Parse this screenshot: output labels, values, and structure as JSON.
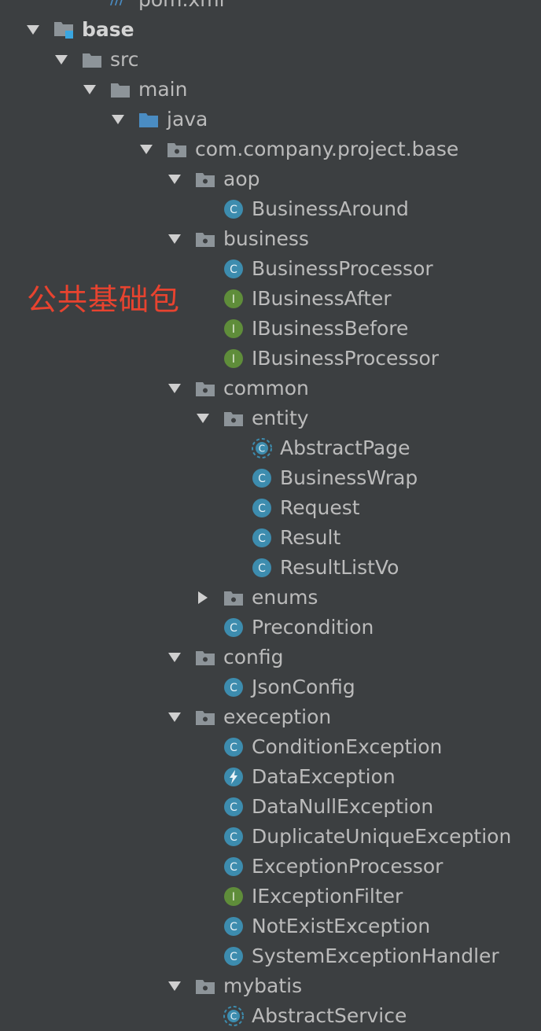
{
  "annotation": "公共基础包",
  "tree": [
    {
      "label": "pom.xml",
      "type": "pom",
      "depth": 2,
      "state": "none"
    },
    {
      "label": "base",
      "type": "module",
      "depth": 0,
      "state": "expanded",
      "bold": true
    },
    {
      "label": "src",
      "type": "folder",
      "depth": 1,
      "state": "expanded"
    },
    {
      "label": "main",
      "type": "folder",
      "depth": 2,
      "state": "expanded"
    },
    {
      "label": "java",
      "type": "source-folder",
      "depth": 3,
      "state": "expanded"
    },
    {
      "label": "com.company.project.base",
      "type": "package",
      "depth": 4,
      "state": "expanded"
    },
    {
      "label": "aop",
      "type": "package",
      "depth": 5,
      "state": "expanded"
    },
    {
      "label": "BusinessAround",
      "type": "class",
      "depth": 6,
      "state": "none"
    },
    {
      "label": "business",
      "type": "package",
      "depth": 5,
      "state": "expanded"
    },
    {
      "label": "BusinessProcessor",
      "type": "class",
      "depth": 6,
      "state": "none"
    },
    {
      "label": "IBusinessAfter",
      "type": "interface",
      "depth": 6,
      "state": "none"
    },
    {
      "label": "IBusinessBefore",
      "type": "interface",
      "depth": 6,
      "state": "none"
    },
    {
      "label": "IBusinessProcessor",
      "type": "interface",
      "depth": 6,
      "state": "none"
    },
    {
      "label": "common",
      "type": "package",
      "depth": 5,
      "state": "expanded"
    },
    {
      "label": "entity",
      "type": "package",
      "depth": 6,
      "state": "expanded"
    },
    {
      "label": "AbstractPage",
      "type": "abstract-class",
      "depth": 7,
      "state": "none"
    },
    {
      "label": "BusinessWrap",
      "type": "class",
      "depth": 7,
      "state": "none"
    },
    {
      "label": "Request",
      "type": "class",
      "depth": 7,
      "state": "none"
    },
    {
      "label": "Result",
      "type": "class",
      "depth": 7,
      "state": "none"
    },
    {
      "label": "ResultListVo",
      "type": "class",
      "depth": 7,
      "state": "none"
    },
    {
      "label": "enums",
      "type": "package",
      "depth": 6,
      "state": "collapsed"
    },
    {
      "label": "Precondition",
      "type": "class",
      "depth": 6,
      "state": "none"
    },
    {
      "label": "config",
      "type": "package",
      "depth": 5,
      "state": "expanded"
    },
    {
      "label": "JsonConfig",
      "type": "class",
      "depth": 6,
      "state": "none"
    },
    {
      "label": "exeception",
      "type": "package",
      "depth": 5,
      "state": "expanded"
    },
    {
      "label": "ConditionException",
      "type": "class",
      "depth": 6,
      "state": "none"
    },
    {
      "label": "DataException",
      "type": "exception",
      "depth": 6,
      "state": "none"
    },
    {
      "label": "DataNullException",
      "type": "class",
      "depth": 6,
      "state": "none"
    },
    {
      "label": "DuplicateUniqueException",
      "type": "class",
      "depth": 6,
      "state": "none"
    },
    {
      "label": "ExceptionProcessor",
      "type": "class",
      "depth": 6,
      "state": "none"
    },
    {
      "label": "IExceptionFilter",
      "type": "interface",
      "depth": 6,
      "state": "none"
    },
    {
      "label": "NotExistException",
      "type": "class",
      "depth": 6,
      "state": "none"
    },
    {
      "label": "SystemExceptionHandler",
      "type": "class",
      "depth": 6,
      "state": "none"
    },
    {
      "label": "mybatis",
      "type": "package",
      "depth": 5,
      "state": "expanded"
    },
    {
      "label": "AbstractService",
      "type": "abstract-class",
      "depth": 6,
      "state": "none"
    }
  ],
  "colors": {
    "background": "#3c3f41",
    "text": "#bbbbbb",
    "arrow": "#cfcfcf",
    "folder": "#8d9499",
    "source_folder": "#4a8cc2",
    "class_icon": "#3d8cae",
    "interface_icon": "#5f8d3a",
    "annotation": "#e8432f"
  }
}
